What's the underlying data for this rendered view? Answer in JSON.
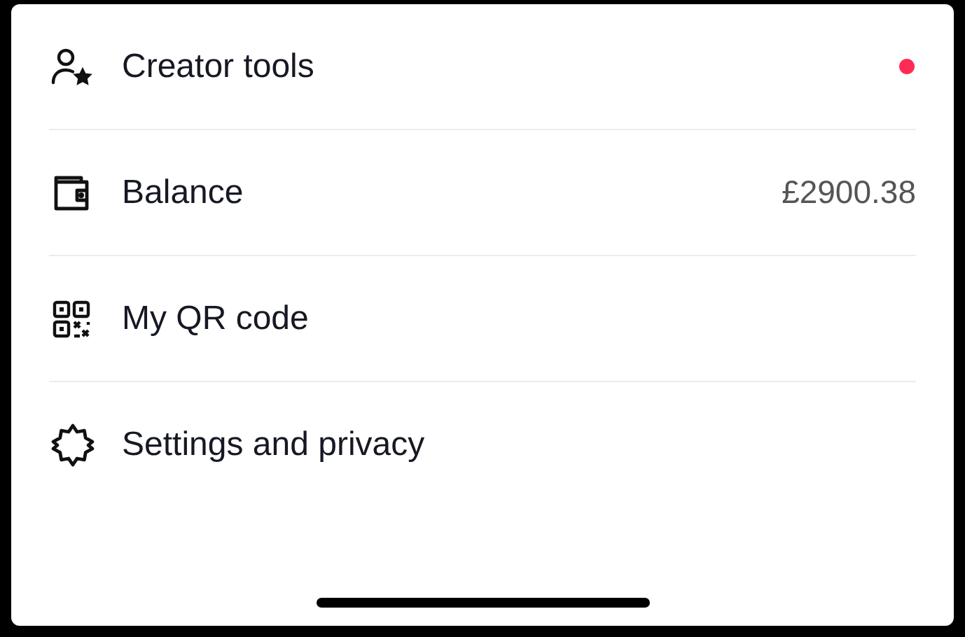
{
  "menu": [
    {
      "kind": "creator",
      "label": "Creator tools",
      "notification_dot": true
    },
    {
      "kind": "wallet",
      "label": "Balance",
      "value": "£2900.38",
      "notification_dot": false
    },
    {
      "kind": "qr",
      "label": "My QR code",
      "notification_dot": false
    },
    {
      "kind": "settings",
      "label": "Settings and privacy",
      "notification_dot": false
    }
  ]
}
